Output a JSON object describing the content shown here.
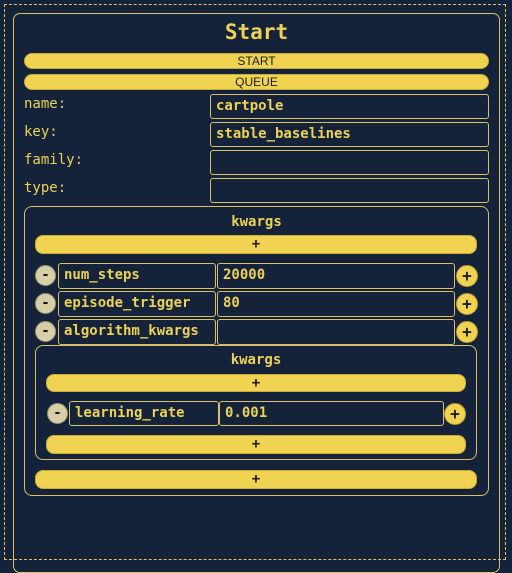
{
  "panel": {
    "title": "Start",
    "start_label": "START",
    "queue_label": "QUEUE"
  },
  "fields": [
    {
      "label": "name:",
      "value": "cartpole"
    },
    {
      "label": "key:",
      "value": "stable_baselines"
    },
    {
      "label": "family:",
      "value": ""
    },
    {
      "label": "type:",
      "value": ""
    }
  ],
  "kwargs": {
    "title": "kwargs",
    "add_label": "+",
    "rows": [
      {
        "key": "num_steps",
        "value": "20000"
      },
      {
        "key": "episode_trigger",
        "value": "80"
      },
      {
        "key": "algorithm_kwargs",
        "value": ""
      }
    ],
    "nested": {
      "title": "kwargs",
      "add_label": "+",
      "rows": [
        {
          "key": "learning_rate",
          "value": "0.001"
        }
      ]
    }
  },
  "controls": {
    "remove_glyph": "-",
    "add_glyph": "+"
  },
  "colors": {
    "background": "#14223a",
    "accent": "#f0d451",
    "text": "#eed256"
  }
}
